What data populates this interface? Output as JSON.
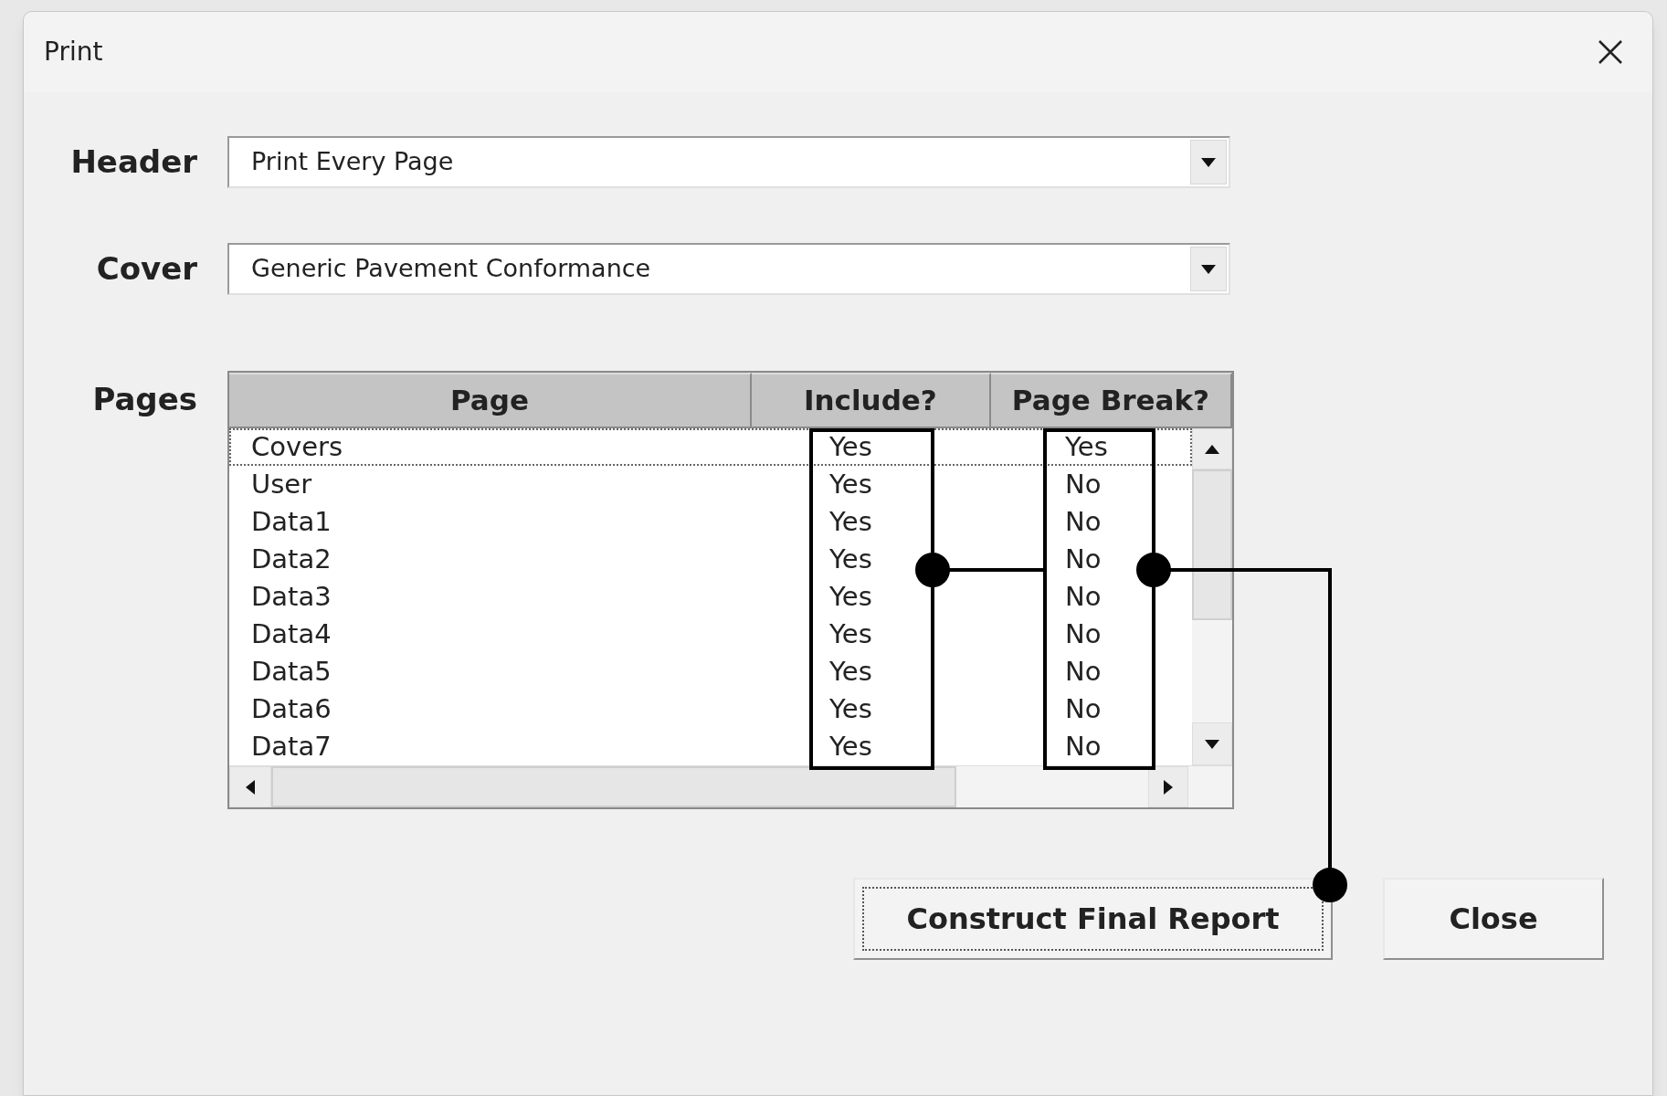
{
  "window": {
    "title": "Print"
  },
  "fields": [
    {
      "label": "Header",
      "value": "Print Every Page"
    },
    {
      "label": "Cover",
      "value": "Generic Pavement Conformance"
    }
  ],
  "pages": {
    "label": "Pages",
    "columns": [
      "Page",
      "Include?",
      "Page Break?"
    ],
    "rows": [
      {
        "page": "Covers",
        "include": "Yes",
        "page_break": "Yes",
        "selected": true
      },
      {
        "page": "User",
        "include": "Yes",
        "page_break": "No",
        "selected": false
      },
      {
        "page": "Data1",
        "include": "Yes",
        "page_break": "No",
        "selected": false
      },
      {
        "page": "Data2",
        "include": "Yes",
        "page_break": "No",
        "selected": false
      },
      {
        "page": "Data3",
        "include": "Yes",
        "page_break": "No",
        "selected": false
      },
      {
        "page": "Data4",
        "include": "Yes",
        "page_break": "No",
        "selected": false
      },
      {
        "page": "Data5",
        "include": "Yes",
        "page_break": "No",
        "selected": false
      },
      {
        "page": "Data6",
        "include": "Yes",
        "page_break": "No",
        "selected": false
      },
      {
        "page": "Data7",
        "include": "Yes",
        "page_break": "No",
        "selected": false
      }
    ]
  },
  "buttons": [
    {
      "label": "Construct Final Report",
      "focused": true
    },
    {
      "label": "Close",
      "focused": false
    }
  ]
}
